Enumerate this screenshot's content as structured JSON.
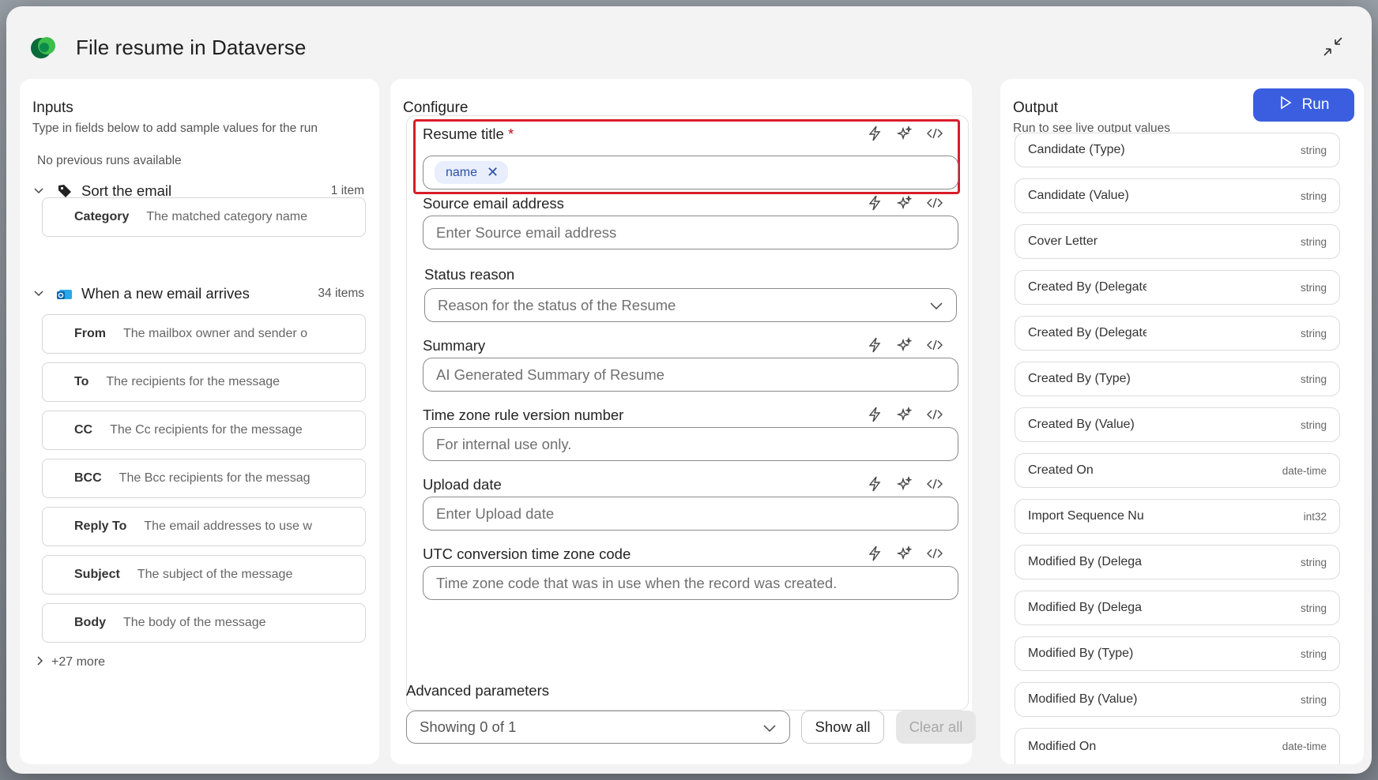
{
  "header": {
    "title": "File resume in Dataverse"
  },
  "inputs": {
    "title": "Inputs",
    "subtitle": "Type in fields below to add sample values for the run",
    "no_runs": "No previous runs available",
    "sections": [
      {
        "label": "Sort the email",
        "count": "1 item",
        "fields": [
          {
            "label": "Category",
            "value": "The matched category name"
          }
        ]
      },
      {
        "label": "When a new email arrives",
        "count": "34 items",
        "fields": [
          {
            "label": "From",
            "value": "The mailbox owner and sender o"
          },
          {
            "label": "To",
            "value": "The recipients for the message"
          },
          {
            "label": "CC",
            "value": "The Cc recipients for the message"
          },
          {
            "label": "BCC",
            "value": "The Bcc recipients for the messag"
          },
          {
            "label": "Reply To",
            "value": "The email addresses to use w"
          },
          {
            "label": "Subject",
            "value": "The subject of the message"
          },
          {
            "label": "Body",
            "value": "The body of the message"
          }
        ]
      }
    ],
    "more": "+27 more"
  },
  "configure": {
    "title": "Configure",
    "fields": [
      {
        "label": "Resume title",
        "required": "*",
        "chip": "name"
      },
      {
        "label": "Source email address",
        "placeholder": "Enter Source email address"
      },
      {
        "label": "Status reason",
        "placeholder": "Reason for the status of the Resume"
      },
      {
        "label": "Summary",
        "placeholder": "AI Generated Summary of Resume"
      },
      {
        "label": "Time zone rule version number",
        "placeholder": "For internal use only."
      },
      {
        "label": "Upload date",
        "placeholder": "Enter Upload date"
      },
      {
        "label": "UTC conversion time zone code",
        "placeholder": "Time zone code that was in use when the record was created."
      }
    ],
    "advanced": {
      "title": "Advanced parameters",
      "select_value": "Showing 0 of 1",
      "show_all": "Show all",
      "clear_all": "Clear all"
    }
  },
  "output": {
    "title": "Output",
    "subtitle": "Run to see live output values",
    "run_label": "Run",
    "rows": [
      {
        "name": "Candidate (Type)",
        "type": "string"
      },
      {
        "name": "Candidate (Value)",
        "type": "string"
      },
      {
        "name": "Cover Letter",
        "type": "string"
      },
      {
        "name": "Created By (Delegate",
        "type": "string"
      },
      {
        "name": "Created By (Delegate",
        "type": "string"
      },
      {
        "name": "Created By (Type)",
        "type": "string"
      },
      {
        "name": "Created By (Value)",
        "type": "string"
      },
      {
        "name": "Created On",
        "type": "date-time"
      },
      {
        "name": "Import Sequence Nu",
        "type": "int32"
      },
      {
        "name": "Modified By (Delega",
        "type": "string"
      },
      {
        "name": "Modified By (Delega",
        "type": "string"
      },
      {
        "name": "Modified By (Type)",
        "type": "string"
      },
      {
        "name": "Modified By (Value)",
        "type": "string"
      },
      {
        "name": "Modified On",
        "type": "date-time"
      }
    ]
  },
  "colors": {
    "accent": "#3b5ee0",
    "highlight": "#d91c29",
    "required": "#c50f1f",
    "chip_bg": "#e8eefc"
  },
  "icons": {
    "logo": "dataverse-logo-icon",
    "minimize": "collapse-arrows-icon",
    "field_actions": [
      "lightning-icon",
      "sparkle-icon",
      "code-icon"
    ]
  }
}
